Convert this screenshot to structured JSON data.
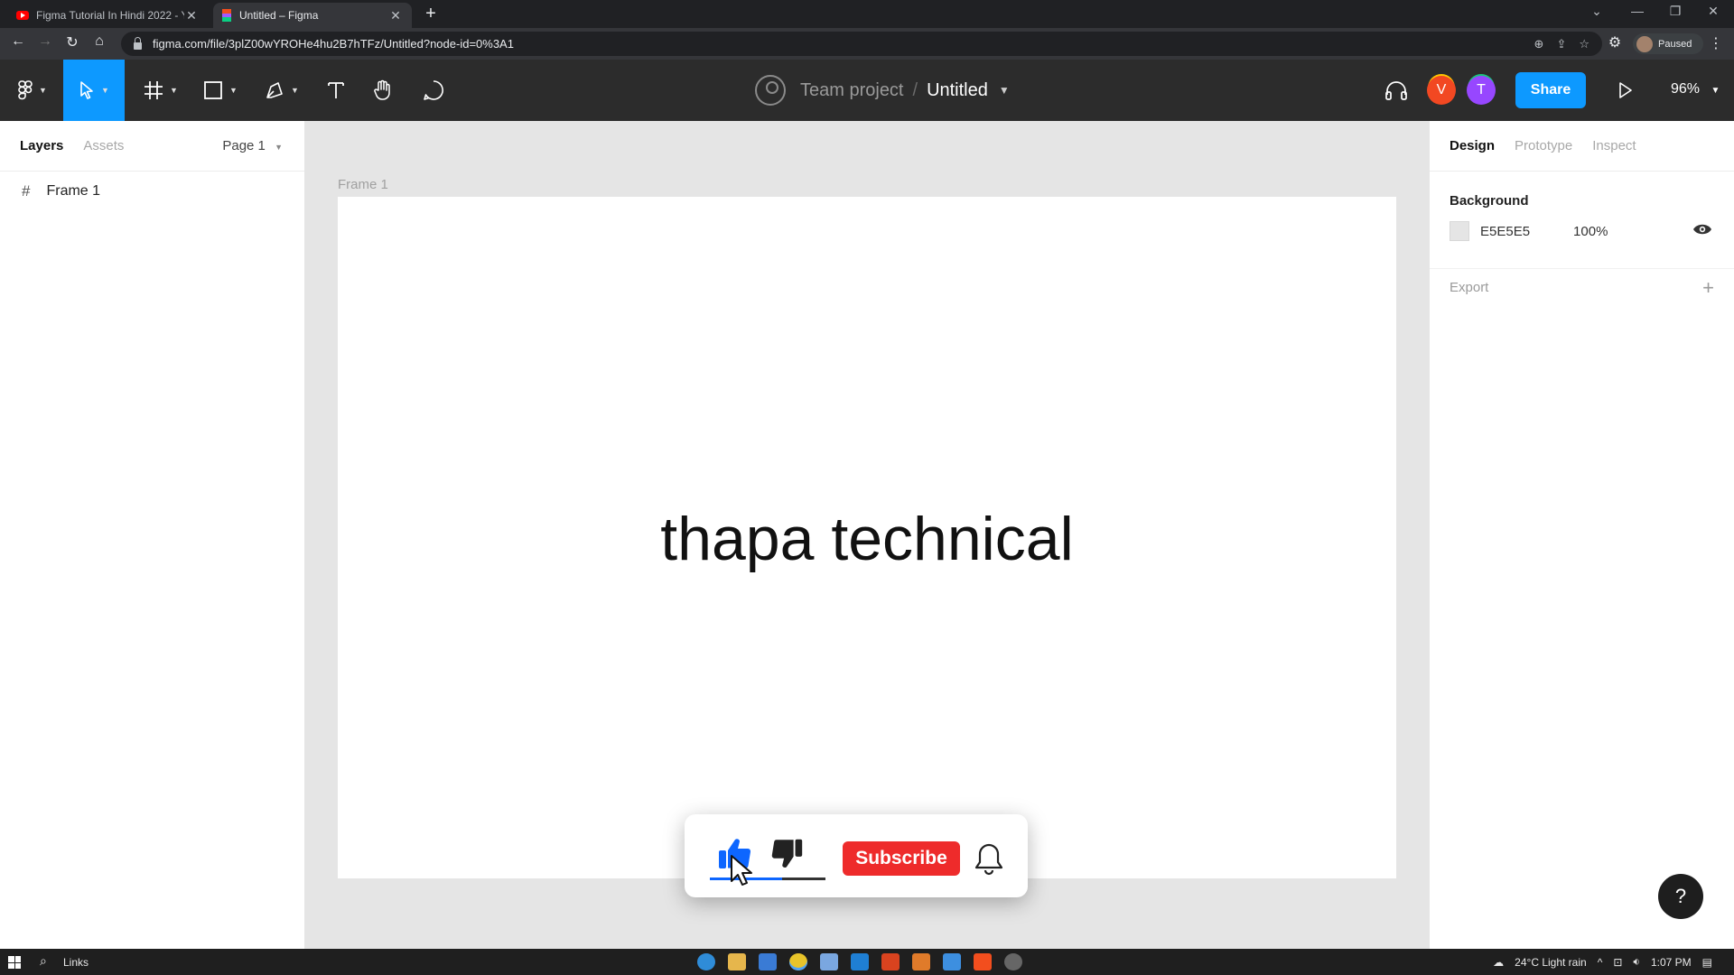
{
  "browser": {
    "tabs": [
      {
        "label": "Figma Tutorial In Hindi 2022 - Yo",
        "active": false
      },
      {
        "label": "Untitled – Figma",
        "active": true
      }
    ],
    "new_tab_label": "+",
    "url": "figma.com/file/3plZ00wYROHe4hu2B7hTFz/Untitled?node-id=0%3A1",
    "profile_status": "Paused"
  },
  "toolbar": {
    "project": "Team project",
    "separator": "/",
    "file_name": "Untitled",
    "users": [
      "V",
      "T"
    ],
    "share_label": "Share",
    "zoom": "96%"
  },
  "left_panel": {
    "tabs": [
      "Layers",
      "Assets"
    ],
    "page": "Page 1",
    "layers": [
      {
        "name": "Frame 1",
        "icon": "frame-icon"
      }
    ]
  },
  "canvas": {
    "frame_label": "Frame 1",
    "text": "thapa technical",
    "overlay": {
      "subscribe_label": "Subscribe"
    }
  },
  "right_panel": {
    "tabs": [
      "Design",
      "Prototype",
      "Inspect"
    ],
    "background_title": "Background",
    "background_hex": "E5E5E5",
    "background_opacity": "100%",
    "export_label": "Export"
  },
  "help_label": "?",
  "taskbar": {
    "search_label": "Links",
    "weather": "24°C  Light rain",
    "time": "1:07 PM"
  },
  "colors": {
    "accent": "#0d99ff",
    "toolbar_bg": "#2c2c2c",
    "canvas_bg": "#e5e5e5",
    "subscribe": "#ee2b2b",
    "avatar_v": "#f24822",
    "avatar_t": "#9747ff"
  }
}
